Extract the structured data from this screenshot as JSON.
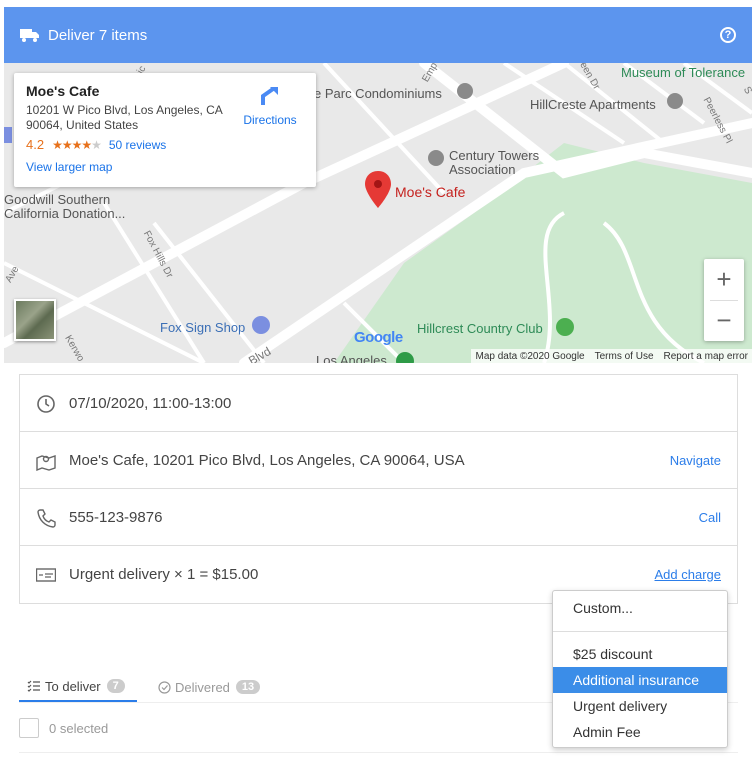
{
  "header": {
    "title": "Deliver 7 items",
    "truck_icon": "truck-icon",
    "help_icon": "help-circle-icon",
    "help_glyph": "?",
    "bg_color": "#5c95ee"
  },
  "map": {
    "info_card": {
      "name": "Moe's Cafe",
      "address": "10201 W Pico Blvd, Los Angeles, CA 90064, United States",
      "rating": "4.2",
      "stars": "★★★★",
      "star_off": "★",
      "reviews": "50 reviews",
      "view_larger": "View larger map",
      "directions": "Directions"
    },
    "labels": {
      "museum": "Museum of Tolerance",
      "condos": "e Parc Condominiums",
      "hillcreste": "HillCreste Apartments",
      "century1": "Century Towers",
      "century2": "Association",
      "moes": "Moe's Cafe",
      "goodwill1": "Goodwill Southern",
      "goodwill2": "California Donation...",
      "foxsign": "Fox Sign Shop",
      "hillcrest": "Hillcrest Country Club",
      "losangeles": "Los Angeles",
      "foxhills": "Fox Hills Dr",
      "peerless": "Peerless Pl",
      "blvd": "Blvd",
      "ave": "Ave",
      "kerwood": "Kerwo",
      "emp": "Emp",
      "green": "reen Dr",
      "pic": "pic",
      "s": "S"
    },
    "google_logo": "Google",
    "attribution": {
      "data": "Map data ©2020 Google",
      "terms": "Terms of Use",
      "report": "Report a map error"
    },
    "zoom_in": "+",
    "zoom_out": "−"
  },
  "details": {
    "datetime": "07/10/2020, 11:00-13:00",
    "address": "Moe's Cafe, 10201 Pico Blvd, Los Angeles, CA 90064, USA",
    "navigate": "Navigate",
    "phone": "555-123-9876",
    "call": "Call",
    "charge": "Urgent delivery × 1 = $15.00",
    "add_charge": "Add charge"
  },
  "dropdown": {
    "items": [
      "Custom...",
      "$25 discount",
      "Additional insurance",
      "Urgent delivery",
      "Admin Fee"
    ],
    "active_index": 2
  },
  "tabs": [
    {
      "label": "To deliver",
      "count": "7"
    },
    {
      "label": "Delivered",
      "count": "13"
    }
  ],
  "selection": {
    "label": "0 selected"
  }
}
